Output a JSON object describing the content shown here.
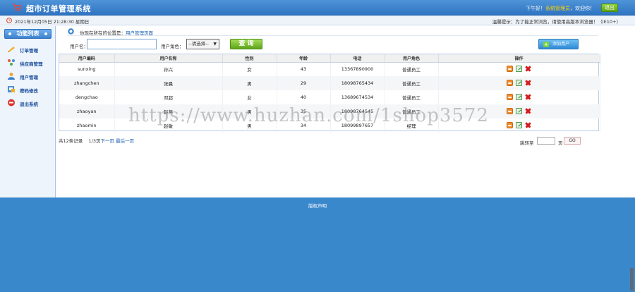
{
  "header": {
    "title": "超市订单管理系统",
    "greeting_prefix": "下午好！",
    "greeting_user": "系统管理员",
    "greeting_suffix": "，欢迎你！",
    "logout_label": "退出"
  },
  "info_bar": {
    "date": "2021年12月05日 21:28:30 星期日",
    "tip": "温馨提示：为了能正常浏览，请使用高版本浏览器！（IE10+）"
  },
  "sidebar": {
    "heading": "功能列表",
    "items": [
      {
        "label": "订单管理",
        "icon": "order-icon"
      },
      {
        "label": "供应商管理",
        "icon": "supplier-icon"
      },
      {
        "label": "用户管理",
        "icon": "user-icon"
      },
      {
        "label": "密码修改",
        "icon": "password-icon"
      },
      {
        "label": "退出系统",
        "icon": "exit-icon"
      }
    ]
  },
  "breadcrumb": {
    "prefix": "你现在所在的位置是：",
    "current": "用户管理页面"
  },
  "search": {
    "username_label": "用户名：",
    "username_value": "",
    "role_label": "用户角色：",
    "role_selected": "--请选择--",
    "query_label": "查 询",
    "add_label": "添加用户"
  },
  "table": {
    "columns": [
      "用户编码",
      "用户名称",
      "性别",
      "年龄",
      "电话",
      "用户角色",
      "操作"
    ],
    "rows": [
      {
        "code": "sunxing",
        "name": "孙兴",
        "gender": "女",
        "age": "43",
        "phone": "13367890900",
        "role": "普通员工"
      },
      {
        "code": "zhangchen",
        "name": "张晨",
        "gender": "男",
        "age": "29",
        "phone": "18098765434",
        "role": "普通员工"
      },
      {
        "code": "dengchao",
        "name": "邓超",
        "gender": "女",
        "age": "40",
        "phone": "13689674534",
        "role": "普通员工"
      },
      {
        "code": "zhaoyan",
        "name": "赵燕",
        "gender": "男",
        "age": "35",
        "phone": "18098764545",
        "role": "普通员工"
      },
      {
        "code": "zhaomin",
        "name": "赵敏",
        "gender": "男",
        "age": "34",
        "phone": "18099897657",
        "role": "经理"
      }
    ]
  },
  "pager": {
    "total": "共12条记录",
    "pages": "1/3页",
    "next": "下一页",
    "last": "最后一页",
    "jump_label": "跳转至",
    "jump_unit": "页",
    "go_label": "GO"
  },
  "footer": {
    "text": "版权声明"
  },
  "watermark": "https://www.huzhan.com/1shop3572",
  "colors": {
    "header": "#2f74c1",
    "footer": "#3a88cc",
    "accent_green": "#5fa51c",
    "link": "#1a5fb4"
  }
}
